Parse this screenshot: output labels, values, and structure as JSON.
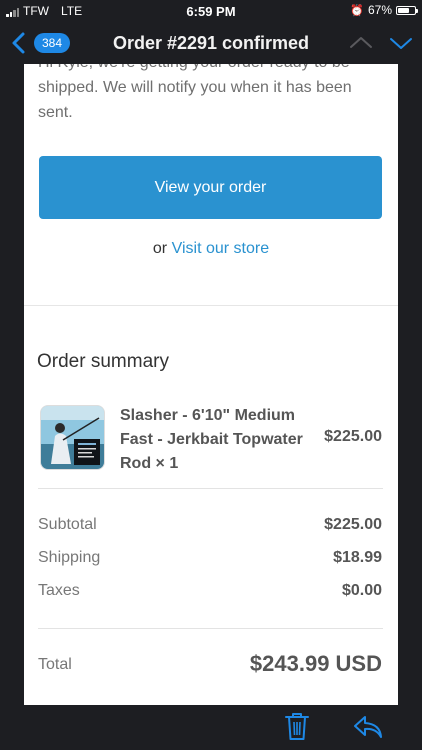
{
  "status_bar": {
    "carrier": "TFW",
    "network": "LTE",
    "time": "6:59 PM",
    "battery": "67%",
    "battery_level": 0.67
  },
  "nav": {
    "back_count": "384",
    "title": "Order #2291 confirmed"
  },
  "email": {
    "intro_text": "Hi Kyle, we're getting your order ready to be shipped. We will notify you when it has been sent.",
    "view_order_label": "View your order",
    "store_prefix": "or",
    "store_link": "Visit our store",
    "summary_title": "Order summary",
    "product": {
      "name": "Slasher - 6'10\" Medium Fast - Jerkbait Topwater Rod × 1",
      "price": "$225.00"
    },
    "totals": {
      "subtotal_label": "Subtotal",
      "subtotal_value": "$225.00",
      "shipping_label": "Shipping",
      "shipping_value": "$18.99",
      "taxes_label": "Taxes",
      "taxes_value": "$0.00",
      "total_label": "Total",
      "total_value": "$243.99 USD"
    }
  },
  "colors": {
    "accent": "#2a92d0",
    "ios_blue": "#1e88e5",
    "background": "#1d1e22"
  },
  "icons": {
    "back": "chevron-left-icon",
    "previous": "chevron-up-icon",
    "next": "chevron-down-icon",
    "trash": "trash-icon",
    "reply": "reply-icon",
    "alarm": "alarm-icon",
    "signal": "signal-icon",
    "battery": "battery-icon"
  }
}
